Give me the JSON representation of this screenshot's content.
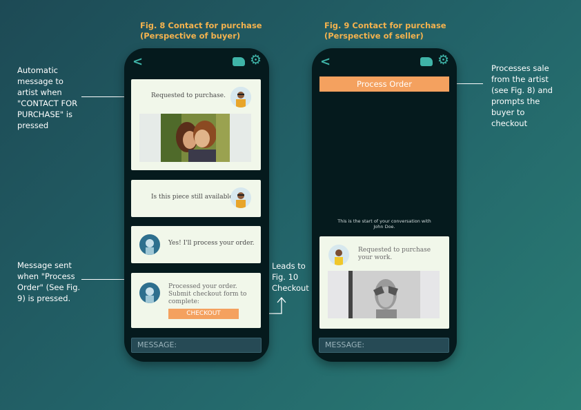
{
  "fig8": {
    "title": "Fig. 8 Contact for purchase\n(Perspective of buyer)",
    "card1_text": "Requested to purchase.",
    "card2_text": "Is this piece still available?",
    "card3_text": "Yes! I'll process your order.",
    "card4_text": "Processed your order.\nSubmit checkout form to\ncomplete:",
    "checkout_label": "CHECKOUT",
    "message_placeholder": "MESSAGE:"
  },
  "fig9": {
    "title": "Fig. 9 Contact for purchase\n(Perspective of seller)",
    "process_order_label": "Process Order",
    "conversation_start": "This is the start of your conversation with\nJohn Doe.",
    "request_text": "Requested to purchase\nyour work.",
    "message_placeholder": "MESSAGE:"
  },
  "notes": {
    "automatic_message": "Automatic\nmessage to\nartist when\n\"CONTACT FOR\nPURCHASE\" is\npressed",
    "message_sent": "Message sent\nwhen \"Process\nOrder\" (See Fig.\n9) is pressed.",
    "leads_to": "Leads to\nFig. 10\nCheckout",
    "processes_sale": "Processes sale\nfrom the artist\n(see Fig. 8) and\nprompts the\nbuyer to\ncheckout"
  },
  "icons": {
    "back": "chevron-left-icon",
    "chat": "chat-bubble-icon",
    "settings": "gear-icon"
  },
  "colors": {
    "accent": "#f3b24e",
    "button": "#f4a15f",
    "icon": "#3fb4a8",
    "phone": "#051a1d",
    "card": "#f1f7ea"
  }
}
